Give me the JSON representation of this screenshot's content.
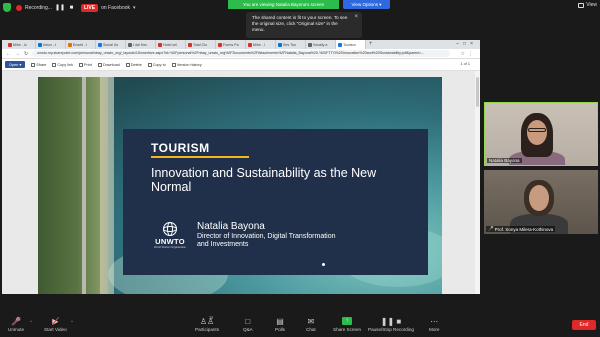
{
  "top_bar": {
    "recording_label": "Recording...",
    "live_label": "LIVE",
    "facebook_label": "on Facebook",
    "banner_text": "You are viewing Natalia Bayona's screen",
    "view_options_label": "View Options ▾",
    "view_label": "View"
  },
  "tooltip": {
    "text": "The shared content is fit to your screen. To see the original size, click \"Original size\" in the menu.",
    "close": "×"
  },
  "browser": {
    "tabs": [
      {
        "label": "Mihe - Ic",
        "color": "#d93025"
      },
      {
        "label": "Inbox - t",
        "color": "#0078d4"
      },
      {
        "label": "Enselt - I",
        "color": "#e37400"
      },
      {
        "label": "Social Us",
        "color": "#1a73e8"
      },
      {
        "label": "I dal Hec",
        "color": "#5f6368"
      },
      {
        "label": "Hotel cel",
        "color": "#d93025"
      },
      {
        "label": "Total Clo",
        "color": "#d93025"
      },
      {
        "label": "Forms Pa",
        "color": "#d93025"
      },
      {
        "label": "Mihe - I",
        "color": "#d93025"
      },
      {
        "label": "Ses Too",
        "color": "#0078d4"
      },
      {
        "label": "Vocally a",
        "color": "#5f6368"
      },
      {
        "label": "Tourism",
        "color": "#1a73e8"
      }
    ],
    "new_tab": "+",
    "url": "unwto-my.sharepoint.com/personal/nbay_unwto_org/_layouts/15/onedrive.aspx?id=%2Fpersonal%2Fnbay_unwto_org%2FDocuments%2FAttachments%2FNatalia_Bayona%20-%20FTTO%20Innovation%20and%20Sustainability.pdf&parent=...",
    "toolbar": {
      "open": "Open ▾",
      "share": "Share",
      "copy_link": "Copy link",
      "print": "Print",
      "download": "Download",
      "delete": "Delete",
      "copy_to": "Copy to",
      "version_history": "Version history"
    },
    "pager": "1 of 1"
  },
  "slide": {
    "label": "TOURISM",
    "heading": "Innovation and Sustainability as the New Normal",
    "logo_text": "UNWTO",
    "logo_sub": "World Tourism Organization",
    "speaker_name": "Natalia Bayona",
    "speaker_role": "Director of Innovation, Digital Transformation and Investments"
  },
  "participants": [
    {
      "name": "Natalia Bayona",
      "muted": false
    },
    {
      "name": "Prof. Sonya Milera-Kothinova",
      "muted": true
    }
  ],
  "bottom_bar": {
    "unmute": "Unmute",
    "start_video": "Start Video",
    "participants": "Participants",
    "participants_count": "72",
    "qa": "Q&A",
    "polls": "Polls",
    "chat": "Chat",
    "share_screen": "Share Screen",
    "pause_recording": "Pause/Stop Recording",
    "more": "More",
    "end": "End"
  },
  "colors": {
    "live": "#e02828",
    "banner_green": "#2dbb4c",
    "view_options_blue": "#2f69e0",
    "slide_card": "#21304a",
    "slide_accent": "#f3b61f",
    "active_speaker": "#96d84b"
  }
}
